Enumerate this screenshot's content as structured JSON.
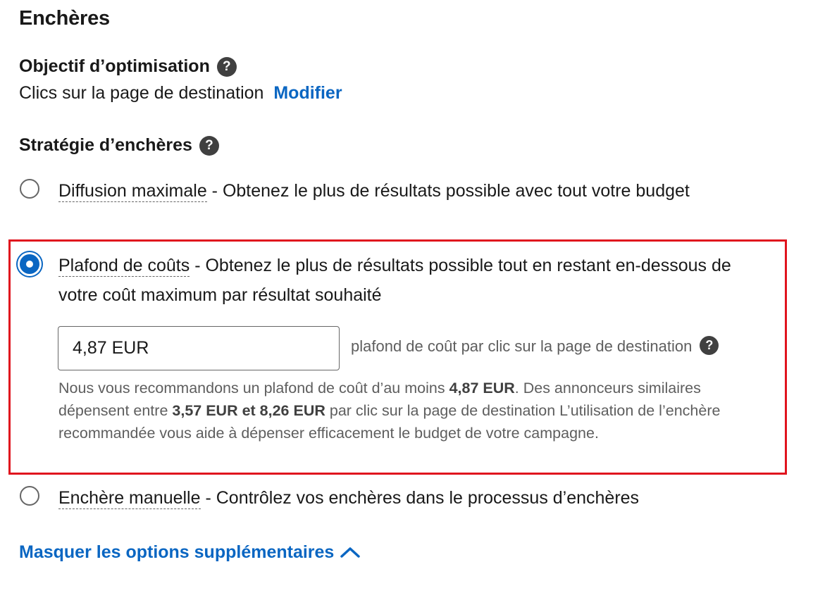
{
  "section": {
    "title": "Enchères"
  },
  "optimization": {
    "heading": "Objectif d’optimisation",
    "value": "Clics sur la page de destination",
    "edit_label": "Modifier"
  },
  "strategy": {
    "heading": "Stratégie d’enchères",
    "options": [
      {
        "name": "Diffusion maximale",
        "description": " - Obtenez le plus de résultats possible avec tout votre budget",
        "selected": false
      },
      {
        "name": "Plafond de coûts",
        "description": " - Obtenez le plus de résultats possible tout en restant en-dessous de votre coût maximum par résultat souhaité",
        "selected": true
      },
      {
        "name": "Enchère manuelle",
        "description": " - Contrôlez vos enchères dans le processus d’enchères",
        "selected": false
      }
    ],
    "cost_cap": {
      "input_value": "4,87 EUR",
      "suffix": "plafond de coût par clic sur la page de destination",
      "rec_part1": "Nous vous recommandons un plafond de coût d’au moins ",
      "rec_min": "4,87 EUR",
      "rec_part2": ". Des annonceurs similaires dépensent entre ",
      "rec_range": "3,57 EUR et 8,26 EUR",
      "rec_part3": " par clic sur la page de destination L’utilisation de l’enchère recommandée vous aide à dépenser efficacement le budget de votre campagne."
    }
  },
  "toggle": {
    "label": "Masquer les options supplémentaires"
  },
  "icons": {
    "help": "question-circle-icon",
    "chevron": "chevron-up-icon"
  },
  "colors": {
    "accent": "#0a66c2",
    "highlight_border": "#e0141e",
    "text": "#191919",
    "muted": "#5e5e5e"
  }
}
